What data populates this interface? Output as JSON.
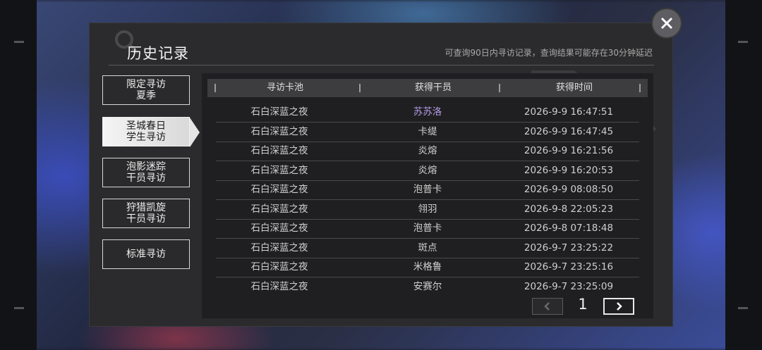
{
  "dialog": {
    "title": "历史记录",
    "notice": "可查询90日内寻访记录，查询结果可能存在30分钟延迟"
  },
  "tabs": [
    {
      "label": "限定寻访\n夏季",
      "active": false
    },
    {
      "label": "圣城春日\n学生寻访",
      "active": true
    },
    {
      "label": "泡影迷踪\n干员寻访",
      "active": false
    },
    {
      "label": "狩猎凯旋\n干员寻访",
      "active": false
    },
    {
      "label": "标准寻访",
      "active": false
    }
  ],
  "table": {
    "headers": [
      "寻访卡池",
      "获得干员",
      "获得时间"
    ],
    "rows": [
      {
        "pool": "石白深蓝之夜",
        "operator": "苏苏洛",
        "time": "2026-9-9 16:47:51",
        "highlight": true
      },
      {
        "pool": "石白深蓝之夜",
        "operator": "卡缇",
        "time": "2026-9-9 16:47:45"
      },
      {
        "pool": "石白深蓝之夜",
        "operator": "炎熔",
        "time": "2026-9-9 16:21:56"
      },
      {
        "pool": "石白深蓝之夜",
        "operator": "炎熔",
        "time": "2026-9-9 16:20:53"
      },
      {
        "pool": "石白深蓝之夜",
        "operator": "泡普卡",
        "time": "2026-9-9 08:08:50"
      },
      {
        "pool": "石白深蓝之夜",
        "operator": "翎羽",
        "time": "2026-9-8 22:05:23"
      },
      {
        "pool": "石白深蓝之夜",
        "operator": "泡普卡",
        "time": "2026-9-8 07:18:48"
      },
      {
        "pool": "石白深蓝之夜",
        "operator": "斑点",
        "time": "2026-9-7 23:25:22"
      },
      {
        "pool": "石白深蓝之夜",
        "operator": "米格鲁",
        "time": "2026-9-7 23:25:16"
      },
      {
        "pool": "石白深蓝之夜",
        "operator": "安赛尔",
        "time": "2026-9-7 23:25:09"
      }
    ]
  },
  "pagination": {
    "current_page": "1"
  },
  "colors": {
    "highlight": "#b69ce8",
    "panel": "#2b2b2d",
    "table_bg": "#1f1f21"
  },
  "icons": [
    "close-icon",
    "chevron-left-icon",
    "chevron-right-icon",
    "search-deco-icon"
  ]
}
